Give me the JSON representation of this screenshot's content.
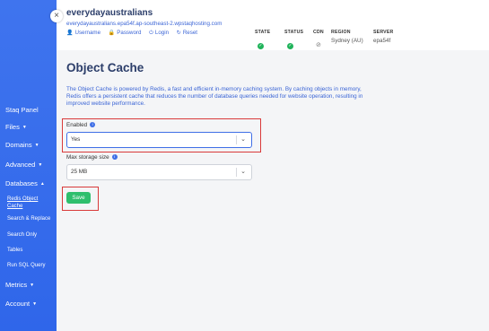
{
  "sidebar": {
    "close_glyph": "×",
    "panel_label": "Staq Panel",
    "items": [
      {
        "label": "Files",
        "caret": "▼"
      },
      {
        "label": "Domains",
        "caret": "▼"
      },
      {
        "label": "Advanced",
        "caret": "▼"
      },
      {
        "label": "Databases",
        "caret": "▲"
      },
      {
        "label": "Metrics",
        "caret": "▼"
      },
      {
        "label": "Account",
        "caret": "▼"
      }
    ],
    "subitems": [
      "Redis Object",
      "Cache",
      "Search & Replace",
      "Search Only",
      "Tables",
      "Run SQL Query"
    ]
  },
  "header": {
    "site_name": "everydayaustralians",
    "site_url": "everydayaustralians.epa54f.ap-southeast-2.wpstaqhosting.com",
    "links": [
      {
        "icon": "user-icon",
        "glyph": "👤",
        "label": "Username"
      },
      {
        "icon": "lock-icon",
        "glyph": "🔒",
        "label": "Password"
      },
      {
        "icon": "login-icon",
        "glyph": "⏻",
        "label": "Login"
      },
      {
        "icon": "reset-icon",
        "glyph": "↻",
        "label": "Reset"
      }
    ],
    "stats": {
      "state": {
        "label": "STATE",
        "status": "ok",
        "glyph": "✓"
      },
      "status": {
        "label": "STATUS",
        "status": "ok",
        "glyph": "✓"
      },
      "cdn": {
        "label": "CDN",
        "status": "off",
        "glyph": "⊘"
      },
      "region": {
        "label": "REGION",
        "value": "Sydney (AU)"
      },
      "server": {
        "label": "SERVER",
        "value": "epa54f"
      }
    },
    "ok_color": "#20b35a"
  },
  "main": {
    "title": "Object Cache",
    "description": "The Object Cache is powered by Redis, a fast and efficient in-memory caching system. By caching objects in memory, Redis offers a persistent cache that reduces the number of database queries needed for website operation, resulting in improved website performance.",
    "enabled": {
      "label": "Enabled",
      "value": "Yes",
      "info": "i"
    },
    "max_storage": {
      "label": "Max storage size",
      "value": "25 MB",
      "info": "i"
    },
    "save_label": "Save",
    "chevron": "⌄",
    "accent_color": "#3f6fe6",
    "highlight_color": "#d93a3a"
  }
}
